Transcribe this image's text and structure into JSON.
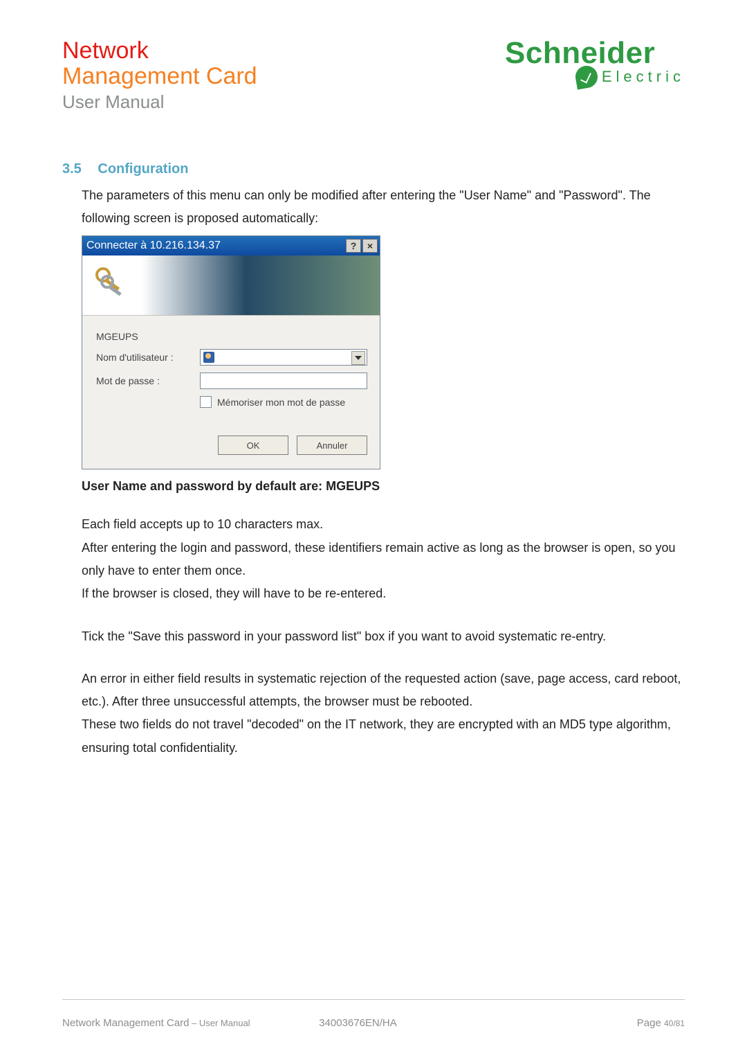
{
  "header": {
    "title_line1": "Network",
    "title_line2": "Management Card",
    "subtitle": "User Manual",
    "logo_brand": "Schneider",
    "logo_sub": "Electric"
  },
  "section": {
    "number": "3.5",
    "title": "Configuration"
  },
  "intro": "The parameters of this menu can only be modified after entering the \"User Name\" and \"Password\". The following screen is proposed automatically:",
  "dialog": {
    "title": "Connecter à 10.216.134.37",
    "help_glyph": "?",
    "close_glyph": "×",
    "realm": "MGEUPS",
    "username_label": "Nom d'utilisateur :",
    "password_label": "Mot de passe :",
    "remember_label": "Mémoriser mon mot de passe",
    "ok_label": "OK",
    "cancel_label": "Annuler"
  },
  "default_creds": "User Name and password by default are: MGEUPS",
  "paragraphs": {
    "p1a": "Each field accepts up to 10 characters max.",
    "p1b": "After entering the login and password, these identifiers remain active as long as the browser is open, so you only have to enter them once.",
    "p1c": "If the browser is closed, they will have to be re-entered.",
    "p2": "Tick the \"Save this password in your password list\" box if you want to avoid systematic re-entry.",
    "p3a": "An error in either field results in systematic rejection of the requested action (save, page access, card reboot, etc.). After three unsuccessful attempts, the browser must be rebooted.",
    "p3b": "These two fields do not travel \"decoded\" on the IT network, they are encrypted with an MD5 type algorithm, ensuring total confidentiality."
  },
  "footer": {
    "left_main": "Network Management Card",
    "left_sub": " – User Manual",
    "doc_ref": "34003676EN/HA",
    "page_label": "Page ",
    "page_num": "40/81"
  }
}
